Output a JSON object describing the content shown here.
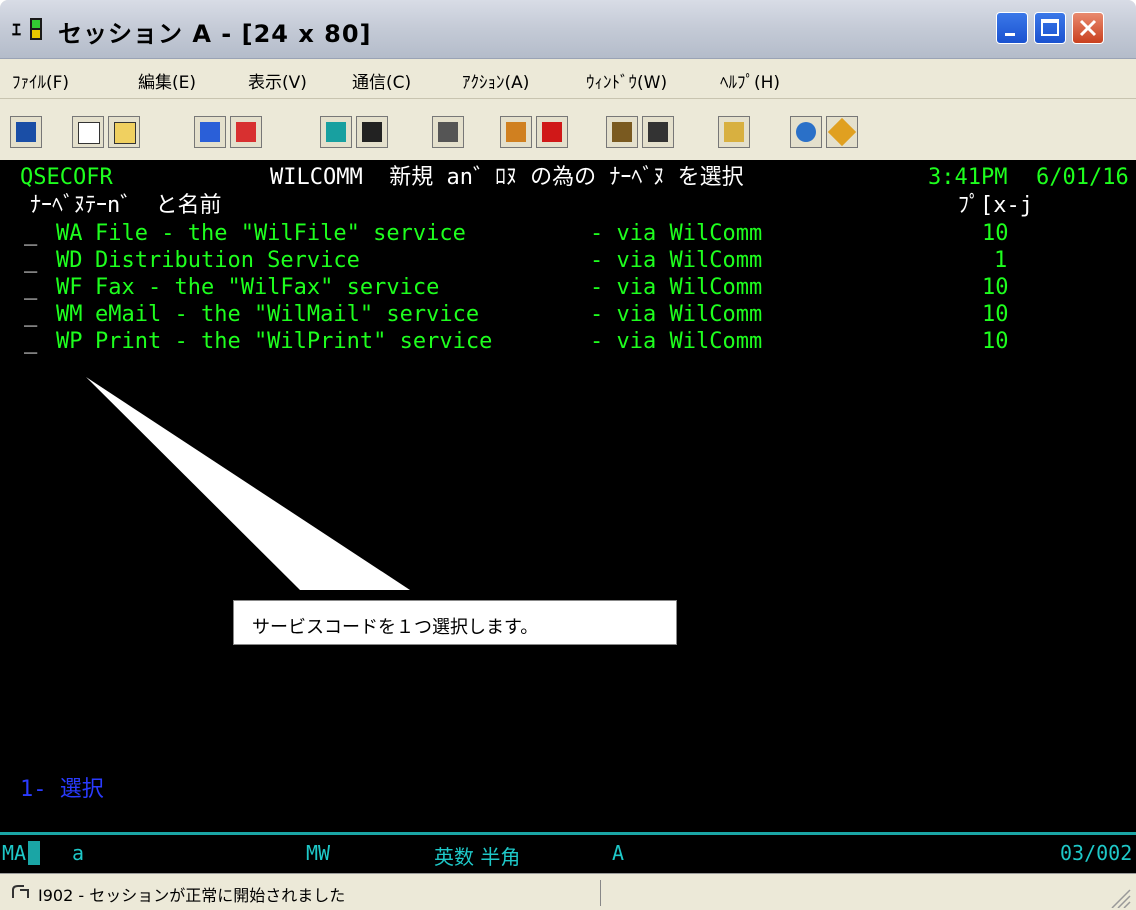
{
  "window": {
    "title": "セッション A - [24 x 80]",
    "app_icon": "terminal-session-icon"
  },
  "title_buttons": [
    "minimize-icon",
    "maximize-icon",
    "close-icon"
  ],
  "menu": [
    "ﾌｧｲﾙ(F)",
    "編集(E)",
    "表示(V)",
    "通信(C)",
    "ｱｸｼｮﾝ(A)",
    "ｳｨﾝﾄﾞｳ(W)",
    "ﾍﾙﾌﾟ(H)"
  ],
  "toolbar": [
    "print-screen-icon",
    "copy-icon",
    "paste-icon",
    "send-file-icon",
    "receive-file-icon",
    "display-setup-icon",
    "keyboard-map-icon",
    "macro-icon",
    "record-macro-icon",
    "stop-macro-icon",
    "play-macro-icon",
    "run-macro-icon",
    "clipboard-icon",
    "globe-icon",
    "help-icon"
  ],
  "terminal": {
    "user": "QSECOFR",
    "title": "WILCOMM  新規 an゛ﾛﾇ の為の ﾅｰﾍﾞﾇ を選択",
    "time": "3:41PM",
    "date": "6/01/16",
    "col_header_left": "ﾅｰﾍﾞﾇﾃｰn゛ と名前",
    "col_header_right": "ﾌﾟ[x-j",
    "rows": [
      {
        "input": "_",
        "code": "WA",
        "name": "File - the \"WilFile\" service",
        "via": "- via WilComm",
        "value": "10"
      },
      {
        "input": "_",
        "code": "WD",
        "name": "Distribution Service",
        "via": "- via WilComm",
        "value": "1"
      },
      {
        "input": "_",
        "code": "WF",
        "name": "Fax - the \"WilFax\" service",
        "via": "- via WilComm",
        "value": "10"
      },
      {
        "input": "_",
        "code": "WM",
        "name": "eMail - the \"WilMail\" service",
        "via": "- via WilComm",
        "value": "10"
      },
      {
        "input": "_",
        "code": "WP",
        "name": "Print - the \"WilPrint\" service",
        "via": "- via WilComm",
        "value": "10"
      }
    ],
    "footer_option": "1- 選択"
  },
  "oia": {
    "left": "MA",
    "shift": "a",
    "mw": "MW",
    "mode": "英数 半角",
    "mode2": "A",
    "cursor": "03/002"
  },
  "status": {
    "text": "I902 - セッションが正常に開始されました",
    "icon": "connection-icon"
  },
  "callout": {
    "text": "サービスコードを１つ選択します。"
  }
}
